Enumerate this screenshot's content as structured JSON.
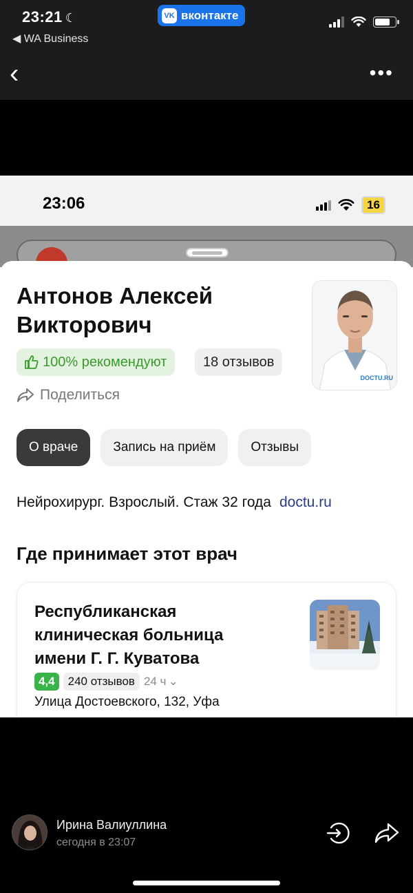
{
  "outer_status": {
    "time": "23:21",
    "back_app": "◀ WA Business",
    "badge": "вконтакте"
  },
  "inner_status": {
    "time": "23:06",
    "battery": "16"
  },
  "doctor": {
    "name": "Антонов Алексей Викторович",
    "recommend": "100% рекомендуют",
    "reviews": "18 отзывов",
    "share": "Поделиться",
    "photo_mark": "DOCTU.RU",
    "specialty": "Нейрохирург. Взрослый. Стаж 32 года",
    "source": "doctu.ru"
  },
  "tabs": [
    {
      "label": "О враче",
      "active": true
    },
    {
      "label": "Запись на приём",
      "active": false
    },
    {
      "label": "Отзывы",
      "active": false
    }
  ],
  "section_title": "Где принимает этот врач",
  "clinic": {
    "name": "Республиканская клиническая больница имени Г. Г. Куватова",
    "rating": "4,4",
    "reviews": "240 отзывов",
    "hours": "24 ч",
    "address": "Улица Достоевского, 132, Уфа"
  },
  "footer": {
    "sender": "Ирина Валиуллина",
    "time": "сегодня в 23:07"
  },
  "colors": {
    "vk_blue": "#1a73e8",
    "green_chip_bg": "#e3f3df",
    "green_text": "#3a9a2c",
    "rating_green": "#3ab34a",
    "active_tab": "#3a3a3a",
    "link_blue": "#2b3b8c"
  }
}
